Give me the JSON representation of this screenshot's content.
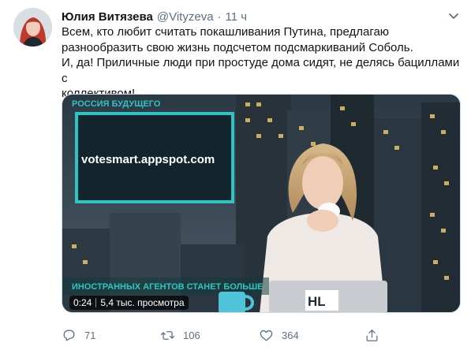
{
  "author": {
    "name": "Юлия Витязева",
    "handle": "@Vityzeva",
    "separator": "·",
    "time": "11 ч"
  },
  "tweet": {
    "lines": [
      "Всем, кто любит считать покашливания Путина, предлагаю",
      "разнообразить свою жизнь подсчетом подсмаркиваний Соболь.",
      "И, да! Приличные люди при простуде дома сидят, не делясь бациллами с",
      "коллективом!"
    ]
  },
  "video": {
    "channel_label": "РОССИЯ БУДУЩЕГО",
    "screen_url": "votesmart.appspot.com",
    "lower_caption": "ИНОСТРАННЫХ АГЕНТОВ СТАНЕТ БОЛЬШЕ",
    "laptop_logo": "HL",
    "duration": "0:24",
    "views": "5,4 тыс. просмотра"
  },
  "actions": {
    "reply_count": "71",
    "retweet_count": "106",
    "like_count": "364"
  },
  "colors": {
    "accent_teal": "#2ec4c4",
    "muted_text": "#5b7083"
  },
  "icons": [
    "caret-down-icon",
    "reply-icon",
    "retweet-icon",
    "like-icon",
    "share-icon"
  ]
}
